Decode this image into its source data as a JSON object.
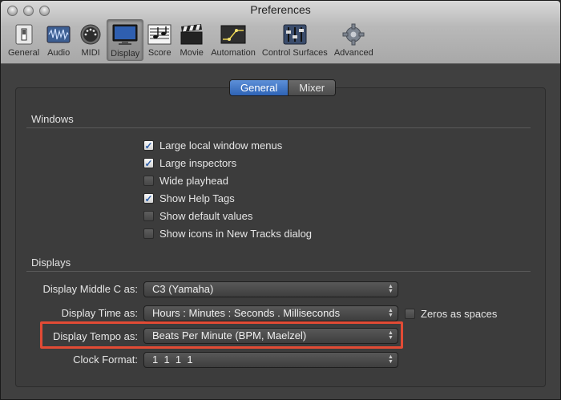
{
  "window": {
    "title": "Preferences"
  },
  "toolbar": {
    "items": [
      {
        "label": "General",
        "icon": "general-switch-icon",
        "active": false
      },
      {
        "label": "Audio",
        "icon": "audio-waveform-icon",
        "active": false
      },
      {
        "label": "MIDI",
        "icon": "midi-port-icon",
        "active": false
      },
      {
        "label": "Display",
        "icon": "display-monitor-icon",
        "active": true
      },
      {
        "label": "Score",
        "icon": "score-notes-icon",
        "active": false
      },
      {
        "label": "Movie",
        "icon": "clapperboard-icon",
        "active": false
      },
      {
        "label": "Automation",
        "icon": "automation-curve-icon",
        "active": false
      },
      {
        "label": "Control Surfaces",
        "icon": "faders-icon",
        "active": false
      },
      {
        "label": "Advanced",
        "icon": "gear-icon",
        "active": false
      }
    ]
  },
  "tabs": [
    {
      "label": "General",
      "selected": true
    },
    {
      "label": "Mixer",
      "selected": false
    }
  ],
  "windows_section": {
    "title": "Windows",
    "options": [
      {
        "label": "Large local window menus",
        "checked": true
      },
      {
        "label": "Large inspectors",
        "checked": true
      },
      {
        "label": "Wide playhead",
        "checked": false
      },
      {
        "label": "Show Help Tags",
        "checked": true
      },
      {
        "label": "Show default values",
        "checked": false
      },
      {
        "label": "Show icons in New Tracks dialog",
        "checked": false
      }
    ]
  },
  "displays_section": {
    "title": "Displays",
    "middle_c": {
      "label": "Display Middle C as:",
      "value": "C3 (Yamaha)"
    },
    "time": {
      "label": "Display Time as:",
      "value": "Hours : Minutes : Seconds . Milliseconds"
    },
    "zeros_as_spaces": {
      "label": "Zeros as spaces",
      "checked": false
    },
    "tempo": {
      "label": "Display Tempo as:",
      "value": "Beats Per Minute (BPM, Maelzel)",
      "highlighted": true
    },
    "clock_format": {
      "label": "Clock Format:",
      "value": "1  1  1  1"
    }
  },
  "colors": {
    "accent": "#2e63b5",
    "highlight": "#e24b35",
    "background": "#404040"
  }
}
